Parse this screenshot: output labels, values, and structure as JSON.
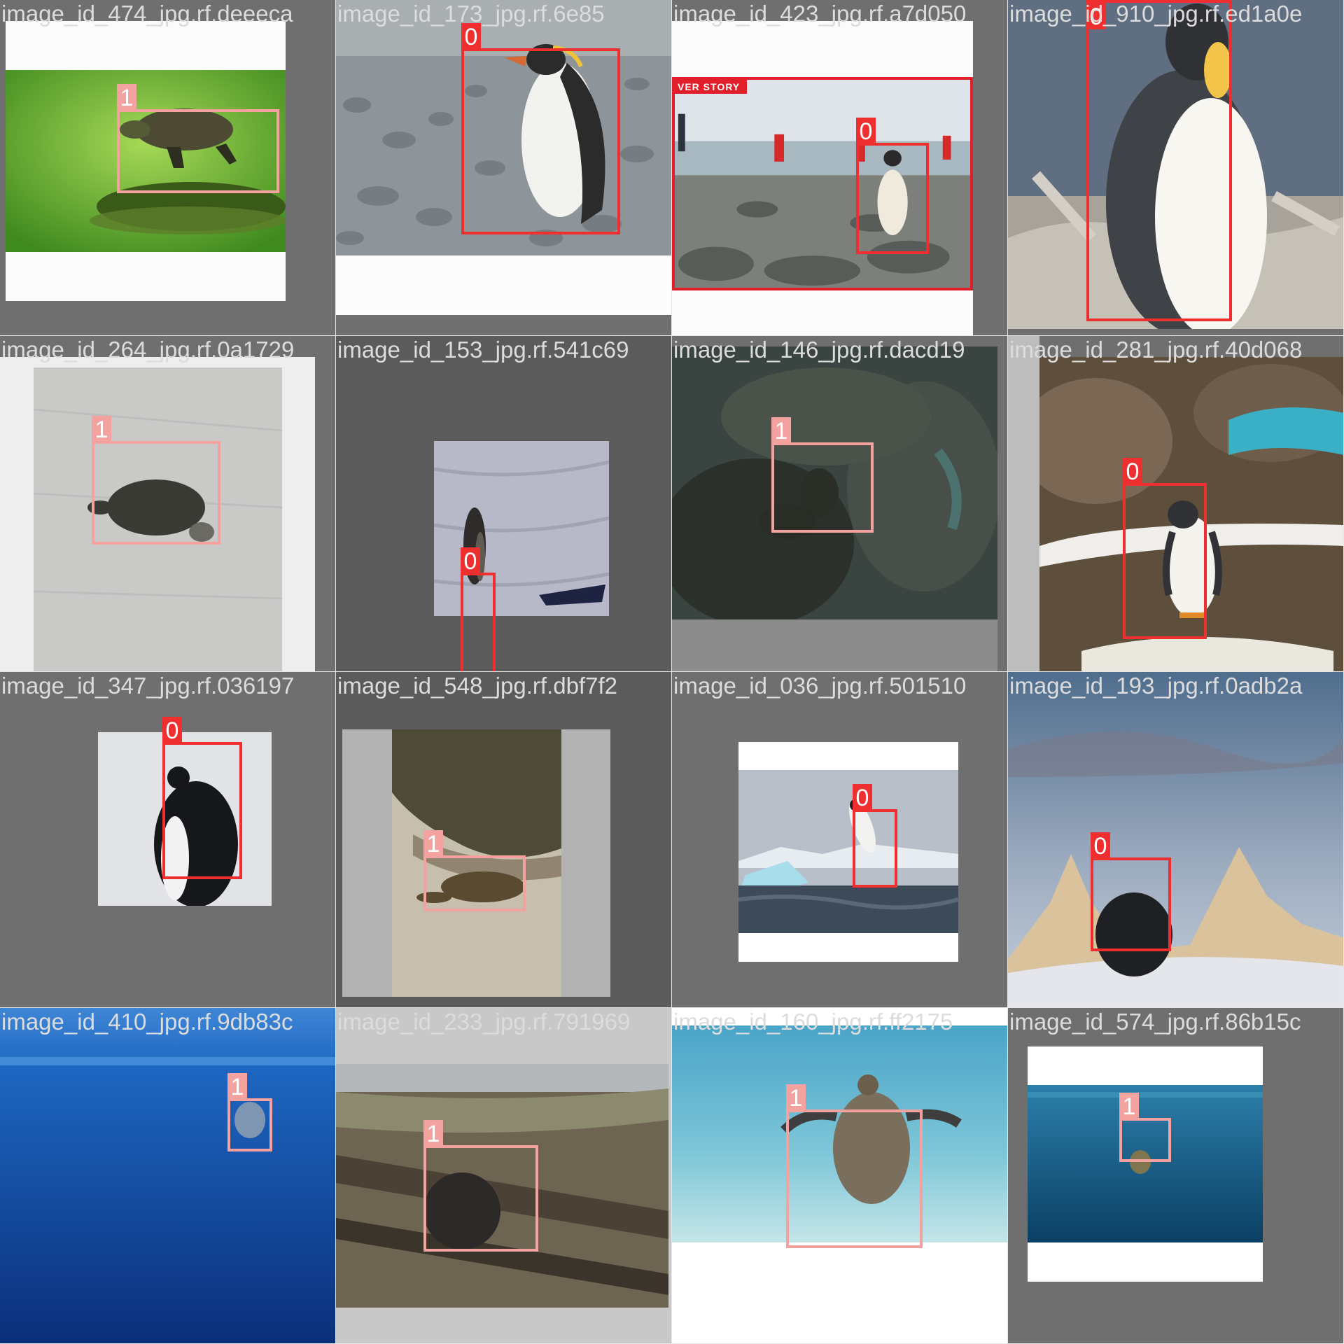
{
  "tiles": [
    {
      "label": "image_id_474_jpg.rf.deeeca",
      "classes": [
        "1"
      ]
    },
    {
      "label": "image_id_173_jpg.rf.6e85",
      "classes": [
        "0"
      ]
    },
    {
      "label": "image_id_423_jpg.rf.a7d050",
      "classes": [
        "0"
      ],
      "banner": "VER STORY"
    },
    {
      "label": "image_id_910_jpg.rf.ed1a0e",
      "classes": [
        "0"
      ]
    },
    {
      "label": "image_id_264_jpg.rf.0a1729",
      "classes": [
        "1"
      ]
    },
    {
      "label": "image_id_153_jpg.rf.541c69",
      "classes": [
        "0"
      ]
    },
    {
      "label": "image_id_146_jpg.rf.dacd19",
      "classes": [
        "1"
      ]
    },
    {
      "label": "image_id_281_jpg.rf.40d068",
      "classes": [
        "0"
      ]
    },
    {
      "label": "image_id_347_jpg.rf.036197",
      "classes": [
        "0"
      ]
    },
    {
      "label": "image_id_548_jpg.rf.dbf7f2",
      "classes": [
        "1"
      ]
    },
    {
      "label": "image_id_036_jpg.rf.501510",
      "classes": [
        "0"
      ]
    },
    {
      "label": "image_id_193_jpg.rf.0adb2a",
      "classes": [
        "0"
      ]
    },
    {
      "label": "image_id_410_jpg.rf.9db83c",
      "classes": [
        "1"
      ]
    },
    {
      "label": "image_id_233_jpg.rf.791969",
      "classes": [
        "1"
      ]
    },
    {
      "label": "image_id_160_jpg.rf.ff2175",
      "classes": [
        "1"
      ]
    },
    {
      "label": "image_id_574_jpg.rf.86b15c",
      "classes": [
        "1"
      ]
    }
  ],
  "colors": {
    "class_0": "#ef2f2f",
    "class_1": "#f4a2a0",
    "tile_background": "#6f6f6f"
  }
}
